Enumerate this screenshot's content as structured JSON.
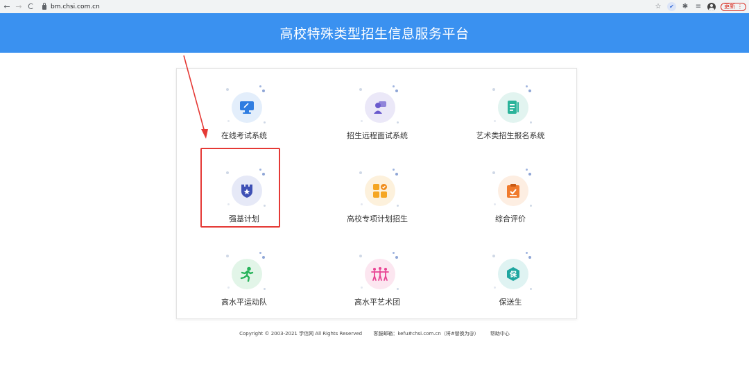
{
  "browser": {
    "url": "bm.chsi.com.cn",
    "update_label": "更新"
  },
  "header": {
    "title": "高校特殊类型招生信息服务平台",
    "color": "#3a91f0"
  },
  "tiles": [
    {
      "label": "在线考试系统",
      "icon": "monitor-icon",
      "color": "#2f7de1",
      "bg": "#e3eefb"
    },
    {
      "label": "招生远程面试系统",
      "icon": "interview-icon",
      "color": "#6a5acd",
      "bg": "#ebe8f8"
    },
    {
      "label": "艺术类招生报名系统",
      "icon": "document-icon",
      "color": "#2bb39a",
      "bg": "#e2f4f0"
    },
    {
      "label": "强基计划",
      "icon": "shield-icon",
      "color": "#3f51b5",
      "bg": "#e6e9f7"
    },
    {
      "label": "高校专项计划招生",
      "icon": "apps-icon",
      "color": "#f5a623",
      "bg": "#fdf1dc"
    },
    {
      "label": "综合评价",
      "icon": "clipboard-icon",
      "color": "#f07a2c",
      "bg": "#fdeee2"
    },
    {
      "label": "高水平运动队",
      "icon": "runner-icon",
      "color": "#27b35a",
      "bg": "#e2f5e8"
    },
    {
      "label": "高水平艺术团",
      "icon": "dancers-icon",
      "color": "#e84393",
      "bg": "#fce6f0"
    },
    {
      "label": "保送生",
      "icon": "badge-icon",
      "color": "#1fa6a0",
      "bg": "#dff3f2"
    }
  ],
  "footer": {
    "copyright": "Copyright © 2003-2021 学信网 All Rights Reserved",
    "email": "客服邮箱：kefu#chsi.com.cn（将#替换为@）",
    "help": "帮助中心"
  },
  "annotation": {
    "highlight_color": "#e53935"
  }
}
